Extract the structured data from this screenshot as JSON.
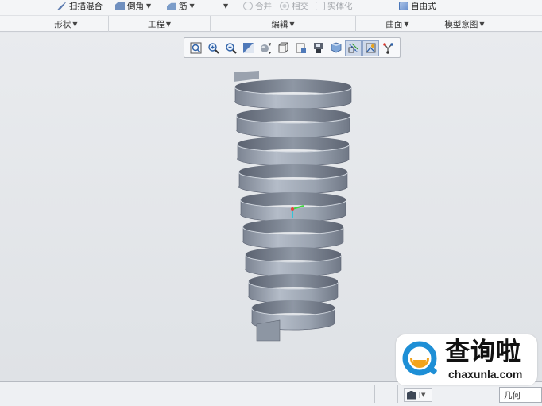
{
  "ribbon": {
    "commands": [
      {
        "label": "扫描混合",
        "icon": "sweep-blend-icon",
        "enabled": true,
        "dropdown": false
      },
      {
        "label": "倒角",
        "icon": "chamfer-icon",
        "enabled": true,
        "dropdown": true
      },
      {
        "label": "筋",
        "icon": "rib-icon",
        "enabled": true,
        "dropdown": true
      },
      {
        "label": "合并",
        "icon": "merge-icon",
        "enabled": false,
        "dropdown": false
      },
      {
        "label": "相交",
        "icon": "intersect-icon",
        "enabled": false,
        "dropdown": false
      },
      {
        "label": "实体化",
        "icon": "solidify-icon",
        "enabled": false,
        "dropdown": false
      },
      {
        "label": "自由式",
        "icon": "freeform-icon",
        "enabled": true,
        "dropdown": false
      }
    ],
    "groups": [
      {
        "label": "形状",
        "dropdown": true
      },
      {
        "label": "工程",
        "dropdown": true
      },
      {
        "label": "编辑",
        "dropdown": true
      },
      {
        "label": "曲面",
        "dropdown": true
      },
      {
        "label": "模型意图",
        "dropdown": true
      }
    ],
    "dropdown_arrow": "▼"
  },
  "view_toolbar": {
    "buttons": [
      {
        "name": "refit-icon",
        "active": false
      },
      {
        "name": "zoom-in-icon",
        "active": false
      },
      {
        "name": "zoom-out-icon",
        "active": false
      },
      {
        "name": "repaint-icon",
        "active": false
      },
      {
        "name": "display-style-icon",
        "active": false
      },
      {
        "name": "saved-orientations-icon",
        "active": false
      },
      {
        "name": "view-manager-icon",
        "active": false
      },
      {
        "name": "perspective-view-icon",
        "active": false
      },
      {
        "name": "annotation-display-icon",
        "active": false
      },
      {
        "name": "datum-display-icon",
        "active": true
      },
      {
        "name": "spin-center-icon",
        "active": true
      },
      {
        "name": "appearance-icon",
        "active": false
      }
    ]
  },
  "status_bar": {
    "filter_icon": "selection-filter-icon",
    "filter_value": "几何"
  },
  "watermark": {
    "logo": "chaxunla-logo",
    "text": "查询啦",
    "url": "chaxunla.com"
  },
  "colors": {
    "spring_light": "#aeb6c2",
    "spring_dark": "#6f7785",
    "spring_shadow": "#4e5563",
    "axis_green": "#3fd93f",
    "axis_cyan": "#35c4d6",
    "logo_blue": "#1e8fd6",
    "logo_orange": "#f2a31b"
  }
}
